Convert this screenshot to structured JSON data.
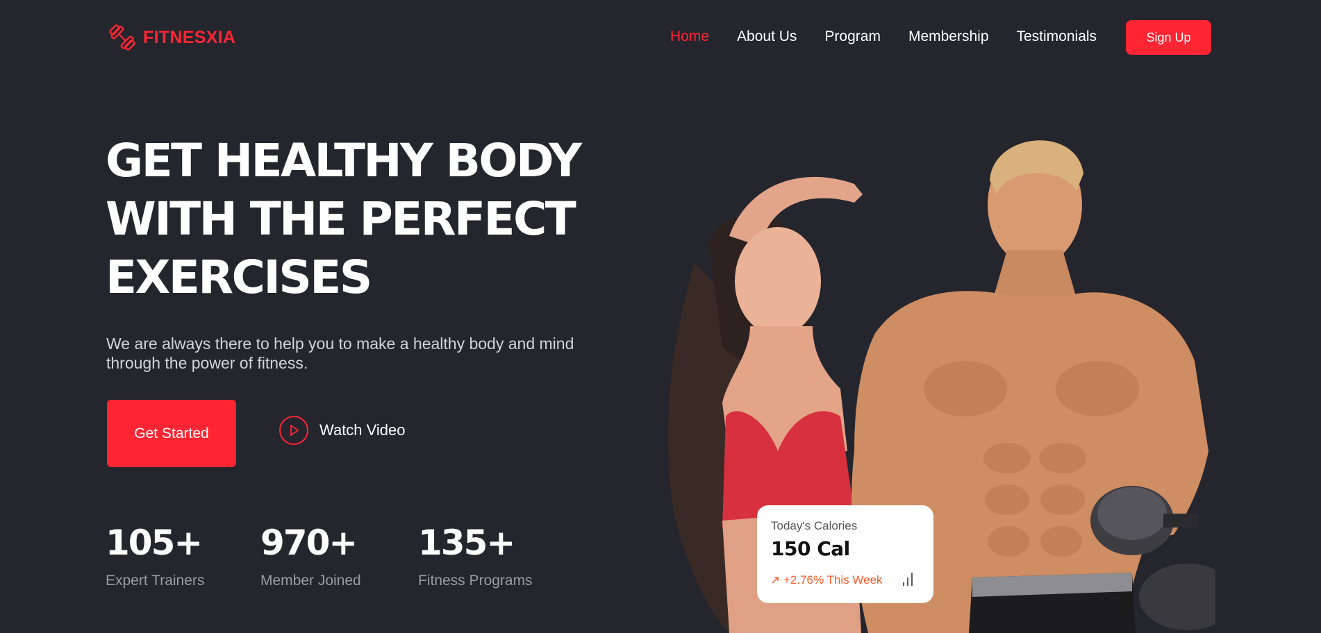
{
  "brand": {
    "name": "FITNESXIA",
    "icon": "dumbbell-icon",
    "accent": "#ff2533"
  },
  "nav": {
    "items": [
      {
        "label": "Home",
        "active": true
      },
      {
        "label": "About Us",
        "active": false
      },
      {
        "label": "Program",
        "active": false
      },
      {
        "label": "Membership",
        "active": false
      },
      {
        "label": "Testimonials",
        "active": false
      }
    ],
    "signup_label": "Sign Up"
  },
  "hero": {
    "headline_lines": [
      "GET HEALTHY BODY",
      "WITH THE PERFECT",
      "EXERCISES"
    ],
    "subtext": "We are always there to help you to make a healthy body and mind through the power of fitness.",
    "primary_cta": "Get Started",
    "video_cta": "Watch Video",
    "video_icon": "play-icon"
  },
  "stats": [
    {
      "value": "105+",
      "label": "Expert Trainers"
    },
    {
      "value": "970+",
      "label": "Member Joined"
    },
    {
      "value": "135+",
      "label": "Fitness Programs"
    }
  ],
  "calories_card": {
    "title": "Today's Calories",
    "value": "150 Cal",
    "trend": "+2.76% This Week",
    "trend_icon": "trend-up-icon",
    "chart_icon": "bar-chart-icon"
  },
  "colors": {
    "background": "#25252d",
    "accent": "#ff2533",
    "trend": "#ff5a2a"
  }
}
